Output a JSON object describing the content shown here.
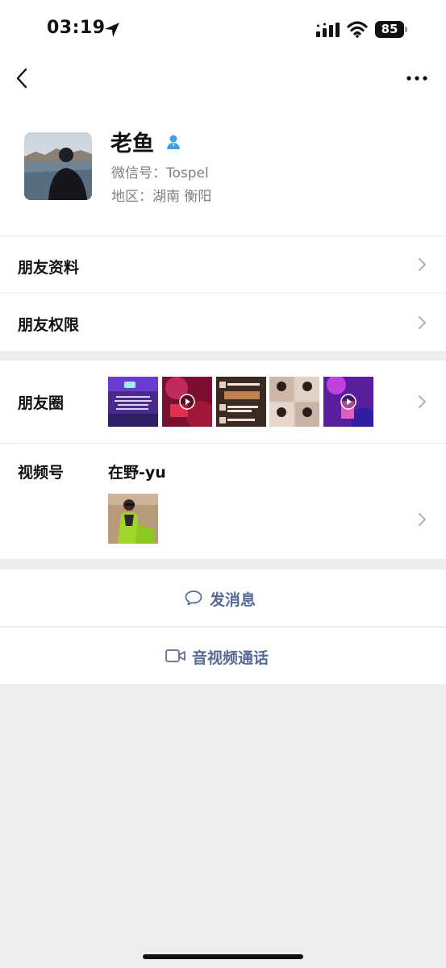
{
  "status_bar": {
    "time": "03:19",
    "battery": "85"
  },
  "profile": {
    "name": "老鱼",
    "wechat_id": "微信号：Tospel",
    "region": "地区：湖南 衡阳"
  },
  "cells": {
    "friend_info": "朋友资料",
    "friend_permissions": "朋友权限",
    "moments": "朋友圈",
    "channels": "视频号",
    "channel_name": "在野-yu"
  },
  "actions": {
    "send_message": "发消息",
    "video_call": "音视频通话"
  },
  "colors": {
    "link": "#576b95",
    "background": "#ededed",
    "contact_badge": "#3ba0e6"
  }
}
